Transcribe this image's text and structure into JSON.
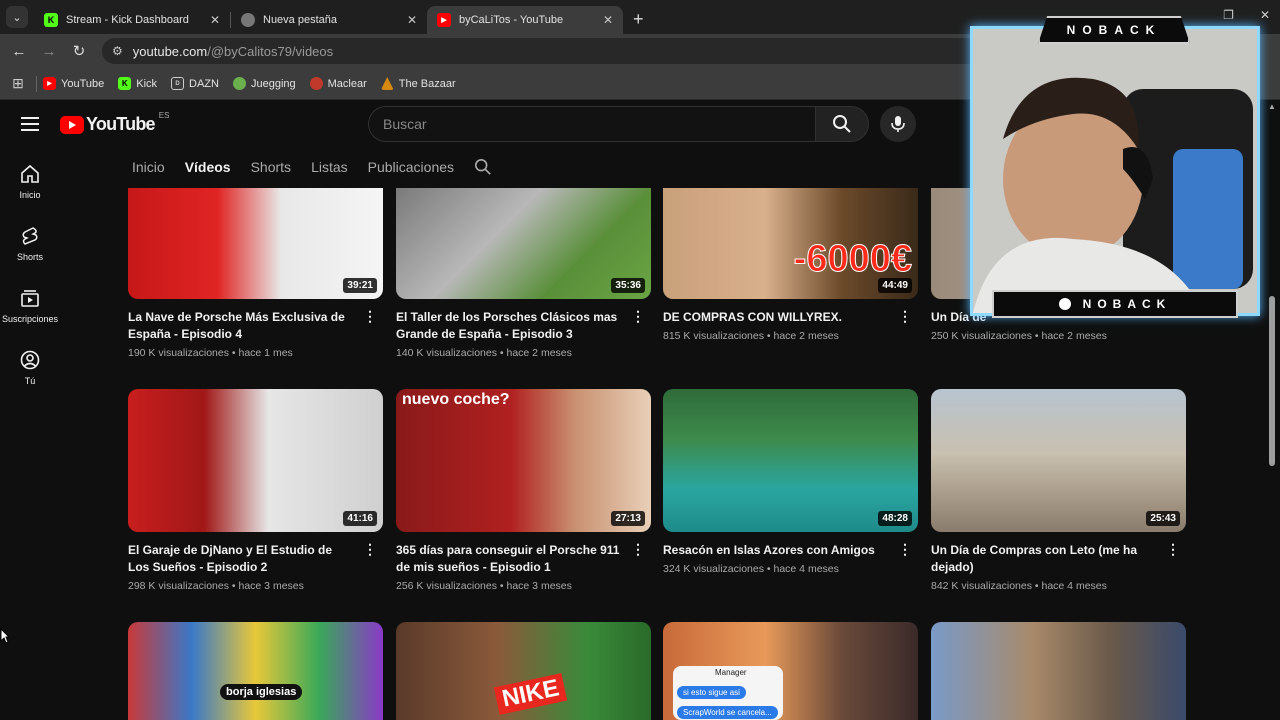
{
  "browser": {
    "tabs": [
      {
        "title": "Stream - Kick Dashboard",
        "icon": "kick-icon",
        "active": false
      },
      {
        "title": "Nueva pestaña",
        "icon": "chrome-icon",
        "active": false
      },
      {
        "title": "byCaLiTos - YouTube",
        "icon": "youtube-icon",
        "active": true
      }
    ],
    "url_host": "youtube.com",
    "url_path": "/@byCalitos79/videos",
    "bookmarks": [
      {
        "label": "YouTube",
        "icon": "youtube-icon"
      },
      {
        "label": "Kick",
        "icon": "kick-icon"
      },
      {
        "label": "DAZN",
        "icon": "dazn-icon"
      },
      {
        "label": "Juegging",
        "icon": "juegging-icon"
      },
      {
        "label": "Maclear",
        "icon": "maclear-icon"
      },
      {
        "label": "The Bazaar",
        "icon": "bazaar-icon"
      }
    ]
  },
  "youtube": {
    "logo_text": "YouTube",
    "country": "ES",
    "search_placeholder": "Buscar",
    "rail": [
      {
        "label": "Inicio",
        "icon": "home-icon"
      },
      {
        "label": "Shorts",
        "icon": "shorts-icon"
      },
      {
        "label": "Suscripciones",
        "icon": "subscriptions-icon"
      },
      {
        "label": "Tú",
        "icon": "you-icon"
      }
    ],
    "channel_tabs": [
      "Inicio",
      "Vídeos",
      "Shorts",
      "Listas",
      "Publicaciones"
    ],
    "active_tab": "Vídeos",
    "videos": [
      {
        "title": "La Nave de Porsche Más Exclusiva de España - Episodio 4",
        "views": "190 K visualizaciones",
        "age": "hace 1 mes",
        "duration": "39:21"
      },
      {
        "title": "El Taller de los Porsches Clásicos mas Grande de España - Episodio 3",
        "views": "140 K visualizaciones",
        "age": "hace 2 meses",
        "duration": "35:36"
      },
      {
        "title": "DE COMPRAS CON WILLYREX.",
        "views": "815 K visualizaciones",
        "age": "hace 2 meses",
        "duration": "44:49",
        "overlay": "-6000€"
      },
      {
        "title": "Un Día de",
        "views": "250 K visualizaciones",
        "age": "hace 2 meses",
        "duration": ""
      },
      {
        "title": "El Garaje de DjNano y El Estudio de Los Sueños - Episodio 2",
        "views": "298 K visualizaciones",
        "age": "hace 3 meses",
        "duration": "41:16"
      },
      {
        "title": "365 días para conseguir el Porsche 911 de mis sueños - Episodio 1",
        "views": "256 K visualizaciones",
        "age": "hace 3 meses",
        "duration": "27:13",
        "overlay": "nuevo coche?"
      },
      {
        "title": "Resacón en Islas Azores con Amigos",
        "views": "324 K visualizaciones",
        "age": "hace 4 meses",
        "duration": "48:28"
      },
      {
        "title": "Un Día de Compras con Leto (me ha dejado)",
        "views": "842 K visualizaciones",
        "age": "hace 4 meses",
        "duration": "25:43"
      }
    ],
    "bottom_thumbs": [
      {
        "overlay": "borja iglesias"
      },
      {
        "overlay": "NIKE"
      },
      {
        "overlay_top": "Manager",
        "overlay_mid": "si esto sigue asi",
        "overlay_bot": "ScrapWorld se cancela..."
      },
      {
        "overlay": ""
      }
    ]
  },
  "webcam": {
    "top_badge": "NOBACK",
    "bottom_badge": "NOBACK"
  },
  "colors": {
    "youtube_red": "#ff0000",
    "kick_green": "#53fc18",
    "frame_blue": "#8fd8ff"
  }
}
